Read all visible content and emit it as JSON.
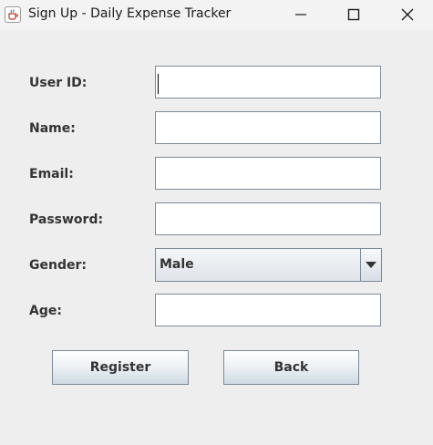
{
  "window": {
    "title": "Sign Up - Daily Expense Tracker",
    "icon": "java-cup-icon",
    "controls": [
      "minimize-icon",
      "maximize-icon",
      "close-icon"
    ]
  },
  "form": {
    "user_id_label": "User ID:",
    "user_id_value": "",
    "name_label": "Name:",
    "name_value": "",
    "email_label": "Email:",
    "email_value": "",
    "password_label": "Password:",
    "password_value": "",
    "gender_label": "Gender:",
    "gender_selected": "Male",
    "age_label": "Age:",
    "age_value": ""
  },
  "buttons": {
    "register_label": "Register",
    "back_label": "Back"
  },
  "colors": {
    "window_bg": "#eeeeee",
    "titlebar_bg": "#f3f3f3",
    "field_border": "#7a8a99",
    "label_text": "#333333"
  }
}
